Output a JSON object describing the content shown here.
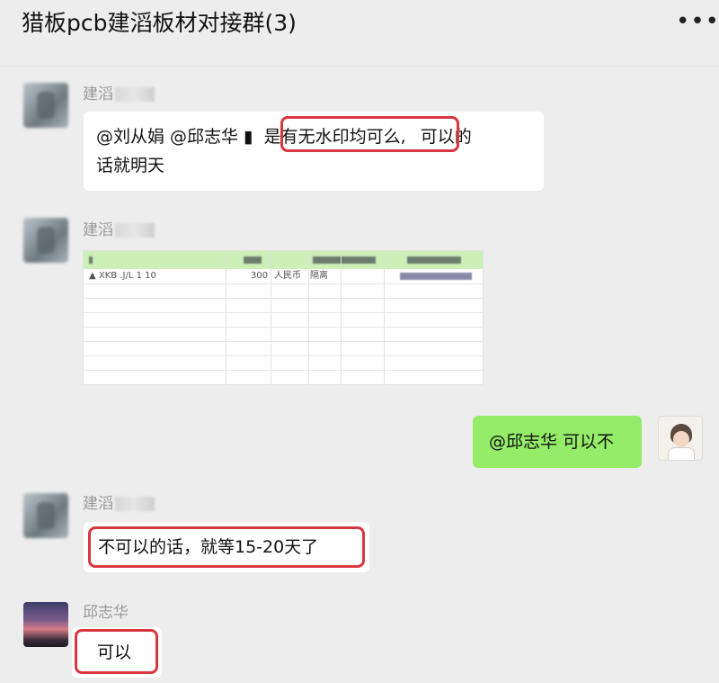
{
  "header": {
    "title": "猎板pcb建滔板材对接群(3)",
    "more_icon": "•••"
  },
  "messages": {
    "m1": {
      "sender": "建滔",
      "line1_a": "@刘从娟 @邱志华 ▮",
      "line1_hl": "是有无水印均可么,",
      "line1_b": "可以的",
      "line2": "话就明天"
    },
    "m2": {
      "sender": "建滔",
      "sheet_cells": [
        "▲ XKB  .J/L 1 10",
        "300",
        "人民币",
        "隔离"
      ]
    },
    "m3": {
      "text": "@邱志华 可以不"
    },
    "m4": {
      "sender": "建滔",
      "text": "不可以的话，就等15-20天了"
    },
    "m5": {
      "sender": "邱志华",
      "text": "可以"
    }
  },
  "colors": {
    "background": "#ededed",
    "self_bubble": "#95ec69",
    "highlight": "#d9373f"
  }
}
